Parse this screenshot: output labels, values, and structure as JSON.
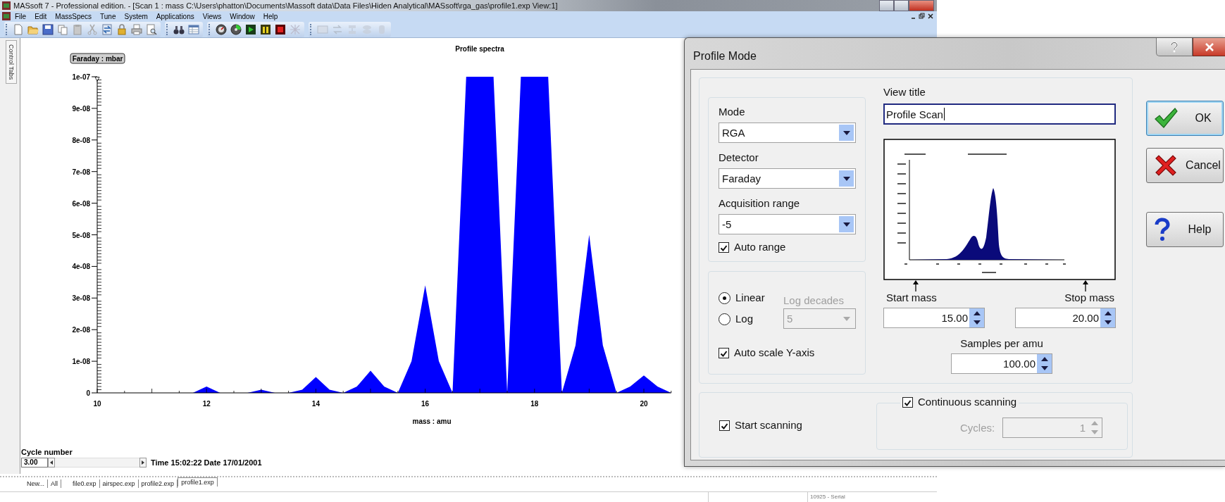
{
  "window": {
    "title": "MASsoft 7 - Professional edition. - [Scan 1 : mass C:\\Users\\phatton\\Documents\\Massoft data\\Data Files\\Hiden Analytical\\MASsoft\\rga_gas\\profile1.exp View:1]"
  },
  "menu": [
    {
      "label": "File"
    },
    {
      "label": "Edit"
    },
    {
      "label": "MassSpecs"
    },
    {
      "label": "Tune"
    },
    {
      "label": "System"
    },
    {
      "label": "Applications"
    },
    {
      "label": "Views"
    },
    {
      "label": "Window"
    },
    {
      "label": "Help"
    }
  ],
  "side_tab": {
    "label": "Control Tabs"
  },
  "chart": {
    "chart_data": {
      "type": "area",
      "title": "Profile spectra",
      "xlabel": "mass : amu",
      "ylabel": "Faraday : mbar",
      "x": [
        11.5,
        11.75,
        12,
        12.25,
        12.5,
        12.75,
        13,
        13.25,
        13.5,
        13.75,
        14,
        14.25,
        14.5,
        14.75,
        15,
        15.25,
        15.5,
        15.75,
        16,
        16.25,
        16.5,
        16.75,
        17,
        17.25,
        17.5,
        17.75,
        18,
        18.25,
        18.5,
        18.75,
        19,
        19.25,
        19.5,
        19.75,
        20,
        20.25,
        20.5
      ],
      "series": [
        {
          "color": "#0000ff",
          "values": [
            0,
            0,
            2e-09,
            0,
            0,
            0,
            1e-09,
            0,
            0,
            1e-09,
            5e-09,
            1e-09,
            0,
            2e-09,
            7e-09,
            2e-09,
            0,
            1e-08,
            3.4e-08,
            1e-08,
            0,
            1e-07,
            1e-07,
            1e-07,
            0,
            1e-07,
            1e-07,
            1e-07,
            0,
            1.5e-08,
            5e-08,
            1.5e-08,
            0,
            2e-09,
            5.5e-09,
            2e-09,
            0
          ]
        }
      ],
      "xlim": [
        10,
        20.5
      ],
      "ylim": [
        0,
        1e-07
      ],
      "xticks": [
        10,
        12,
        14,
        16,
        18,
        20
      ],
      "yticks": [
        {
          "value": 0,
          "label": "0"
        },
        {
          "value": 1e-08,
          "label": "1e-08"
        },
        {
          "value": 2e-08,
          "label": "2e-08"
        },
        {
          "value": 3e-08,
          "label": "3e-08"
        },
        {
          "value": 4e-08,
          "label": "4e-08"
        },
        {
          "value": 5e-08,
          "label": "5e-08"
        },
        {
          "value": 6e-08,
          "label": "6e-08"
        },
        {
          "value": 7e-08,
          "label": "7e-08"
        },
        {
          "value": 8e-08,
          "label": "8e-08"
        },
        {
          "value": 9e-08,
          "label": "9e-08"
        },
        {
          "value": 1e-07,
          "label": "1e-07"
        }
      ]
    }
  },
  "cycle": {
    "label": "Cycle number",
    "value": "3.00",
    "time": "Time 15:02:22 Date 17/01/2001"
  },
  "file_tabs": [
    {
      "label": "New...",
      "selected": false
    },
    {
      "label": "All",
      "selected": false
    },
    {
      "label": "file0.exp",
      "selected": false
    },
    {
      "label": "airspec.exp",
      "selected": false
    },
    {
      "label": "profile2.exp",
      "selected": false
    },
    {
      "label": "profile1.exp",
      "selected": true
    }
  ],
  "status_bar": {
    "panel_3": "10925 - Serial"
  },
  "dialog": {
    "title": "Profile Mode",
    "mode": {
      "label": "Mode",
      "value": "RGA"
    },
    "detector": {
      "label": "Detector",
      "value": "Faraday"
    },
    "acquisition_range": {
      "label": "Acquisition range",
      "value": "-5"
    },
    "auto_range": {
      "label": "Auto range",
      "checked": true
    },
    "scale": [
      {
        "label": "Linear",
        "selected": true
      },
      {
        "label": "Log",
        "selected": false
      }
    ],
    "log_decades": {
      "label": "Log decades",
      "value": "5",
      "disabled": true
    },
    "auto_scale": {
      "label": "Auto scale Y-axis",
      "checked": true
    },
    "view_title": {
      "label": "View title",
      "value": "Profile Scan"
    },
    "start_mass": {
      "label": "Start mass",
      "value": "15.00"
    },
    "stop_mass": {
      "label": "Stop mass",
      "value": "20.00"
    },
    "samples": {
      "label": "Samples per amu",
      "value": "100.00"
    },
    "start_scanning": {
      "label": "Start scanning",
      "checked": true
    },
    "continuous": {
      "label": "Continuous scanning",
      "checked": true
    },
    "cycles": {
      "label": "Cycles:",
      "value": "1",
      "disabled": true
    },
    "buttons": [
      {
        "kind": "ok",
        "label": "OK",
        "focused": true
      },
      {
        "kind": "cancel",
        "label": "Cancel",
        "focused": false
      },
      {
        "kind": "help",
        "label": "Help",
        "focused": false
      }
    ]
  }
}
